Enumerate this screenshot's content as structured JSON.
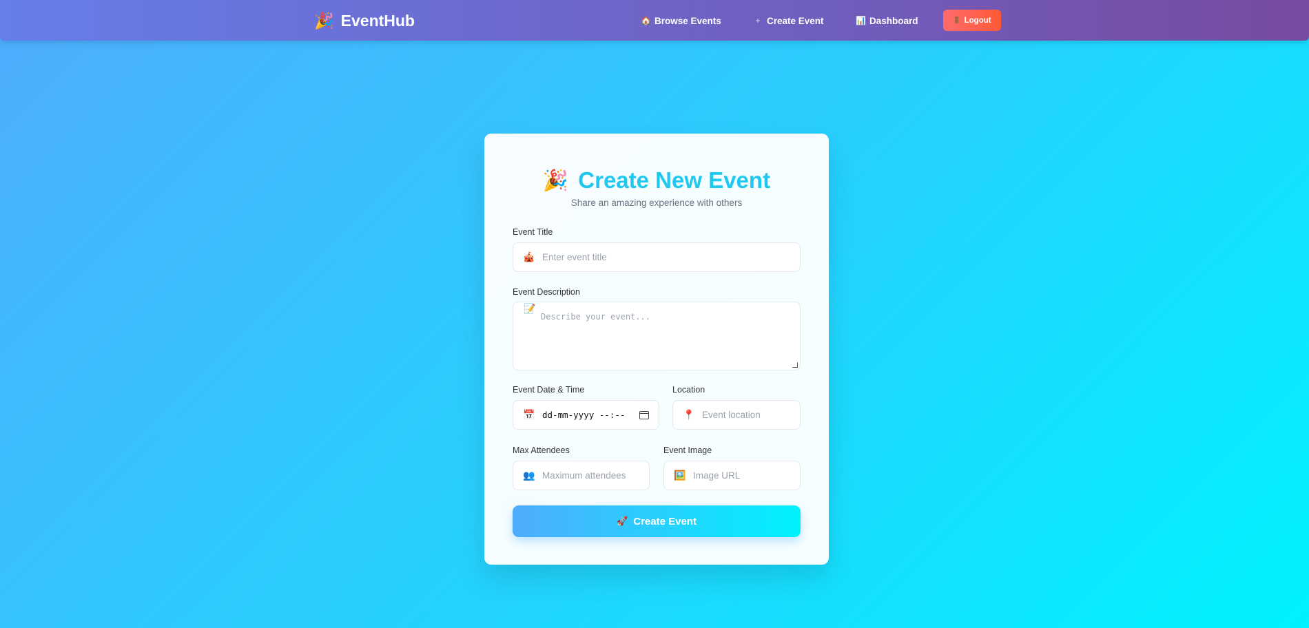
{
  "navbar": {
    "brand_icon": "🎉",
    "brand_name": "EventHub",
    "links": [
      {
        "icon": "🏠",
        "label": "Browse Events"
      },
      {
        "icon": "+",
        "label": "Create Event"
      },
      {
        "icon": "📊",
        "label": "Dashboard"
      }
    ],
    "logout_icon": "🚪",
    "logout_label": "Logout"
  },
  "form": {
    "title_icon": "🎉",
    "title": "Create New Event",
    "subtitle": "Share an amazing experience with others",
    "fields": {
      "title": {
        "label": "Event Title",
        "icon": "🎪",
        "placeholder": "Enter event title"
      },
      "description": {
        "label": "Event Description",
        "icon": "📝",
        "placeholder": "Describe your event..."
      },
      "datetime": {
        "label": "Event Date & Time",
        "icon": "📅",
        "value": "dd-mm-yyyy --:--"
      },
      "location": {
        "label": "Location",
        "icon": "📍",
        "placeholder": "Event location"
      },
      "max_attendees": {
        "label": "Max Attendees",
        "icon": "👥",
        "placeholder": "Maximum attendees"
      },
      "image": {
        "label": "Event Image",
        "icon": "🖼️",
        "placeholder": "Image URL"
      }
    },
    "submit_icon": "🚀",
    "submit_label": "Create Event"
  },
  "colors": {
    "background_start": "#4facfe",
    "background_end": "#00f2fe",
    "navbar_start": "#667eea",
    "navbar_end": "#764ba2",
    "title_color": "#1fc8ef",
    "logout_color": "#ff6b6b"
  }
}
